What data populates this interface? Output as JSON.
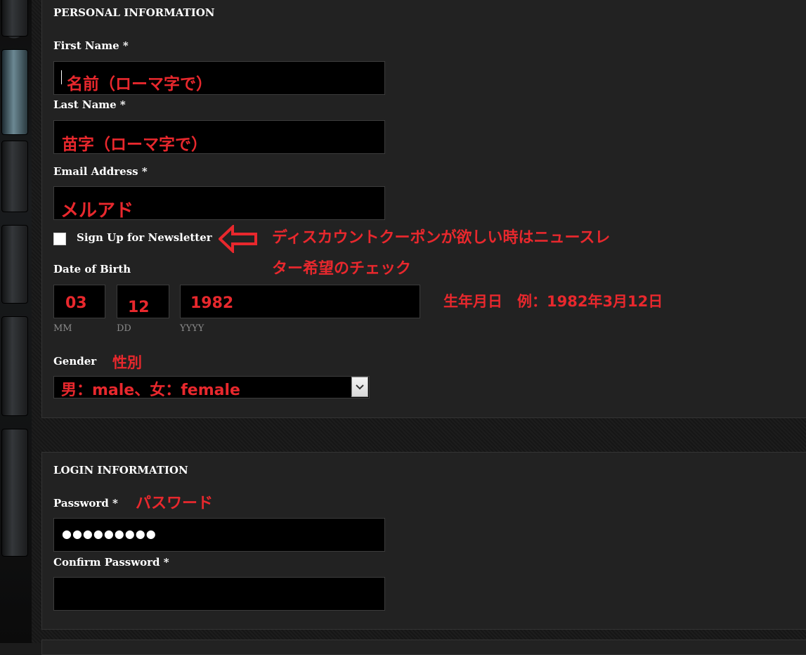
{
  "personal": {
    "title": "PERSONAL INFORMATION",
    "first_name_label": "First Name *",
    "first_name_value": "名前（ローマ字で）",
    "last_name_label": "Last Name *",
    "last_name_value": "苗字（ローマ字で）",
    "email_label": "Email Address *",
    "email_value": "メルアド",
    "newsletter_label": "Sign Up for Newsletter",
    "newsletter_checked": false,
    "newsletter_note_line1": "ディスカウントクーポンが欲しい時はニュースレ",
    "newsletter_note_line2": "ター希望のチェック",
    "dob_label": "Date of Birth",
    "dob_month": "03",
    "dob_day": "12",
    "dob_year": "1982",
    "dob_month_hint": "MM",
    "dob_day_hint": "DD",
    "dob_year_hint": "YYYY",
    "dob_note": "生年月日　例：1982年3月12日",
    "gender_label": "Gender",
    "gender_note": "性別",
    "gender_value": "男：male、女：female"
  },
  "login": {
    "title": "LOGIN INFORMATION",
    "password_label": "Password *",
    "password_note": "パスワード",
    "password_value": "●●●●●●●●●",
    "confirm_label": "Confirm Password *",
    "confirm_value": ""
  },
  "colors": {
    "annotation_red": "#e8282d",
    "panel_bg": "#222222",
    "field_bg": "#000000"
  },
  "icons": {
    "arrow": "left-arrow-icon",
    "select": "chevron-down-icon"
  }
}
